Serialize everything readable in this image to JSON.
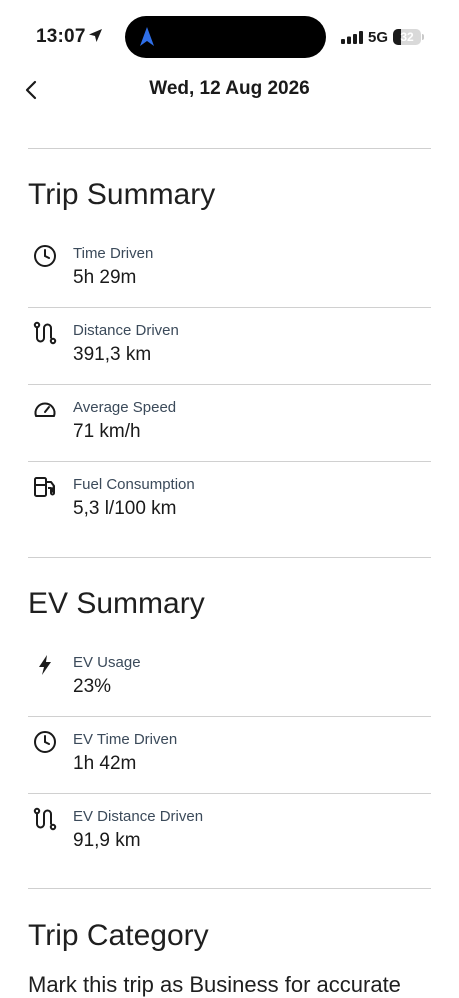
{
  "status_bar": {
    "time": "13:07",
    "network": "5G",
    "battery": "32"
  },
  "header": {
    "date": "Wed, 12 Aug 2026"
  },
  "trip_summary": {
    "title": "Trip Summary",
    "items": [
      {
        "icon": "clock-icon",
        "label": "Time Driven",
        "value": "5h 29m"
      },
      {
        "icon": "route-icon",
        "label": "Distance Driven",
        "value": "391,3 km"
      },
      {
        "icon": "speedometer-icon",
        "label": "Average Speed",
        "value": "71 km/h"
      },
      {
        "icon": "fuel-pump-icon",
        "label": "Fuel Consumption",
        "value": "5,3 l/100 km"
      }
    ]
  },
  "ev_summary": {
    "title": "EV Summary",
    "items": [
      {
        "icon": "lightning-icon",
        "label": "EV Usage",
        "value": "23%"
      },
      {
        "icon": "clock-icon",
        "label": "EV Time Driven",
        "value": "1h 42m"
      },
      {
        "icon": "route-icon",
        "label": "EV Distance Driven",
        "value": "91,9 km"
      }
    ]
  },
  "trip_category": {
    "title": "Trip Category",
    "description": "Mark this trip as Business for accurate"
  }
}
